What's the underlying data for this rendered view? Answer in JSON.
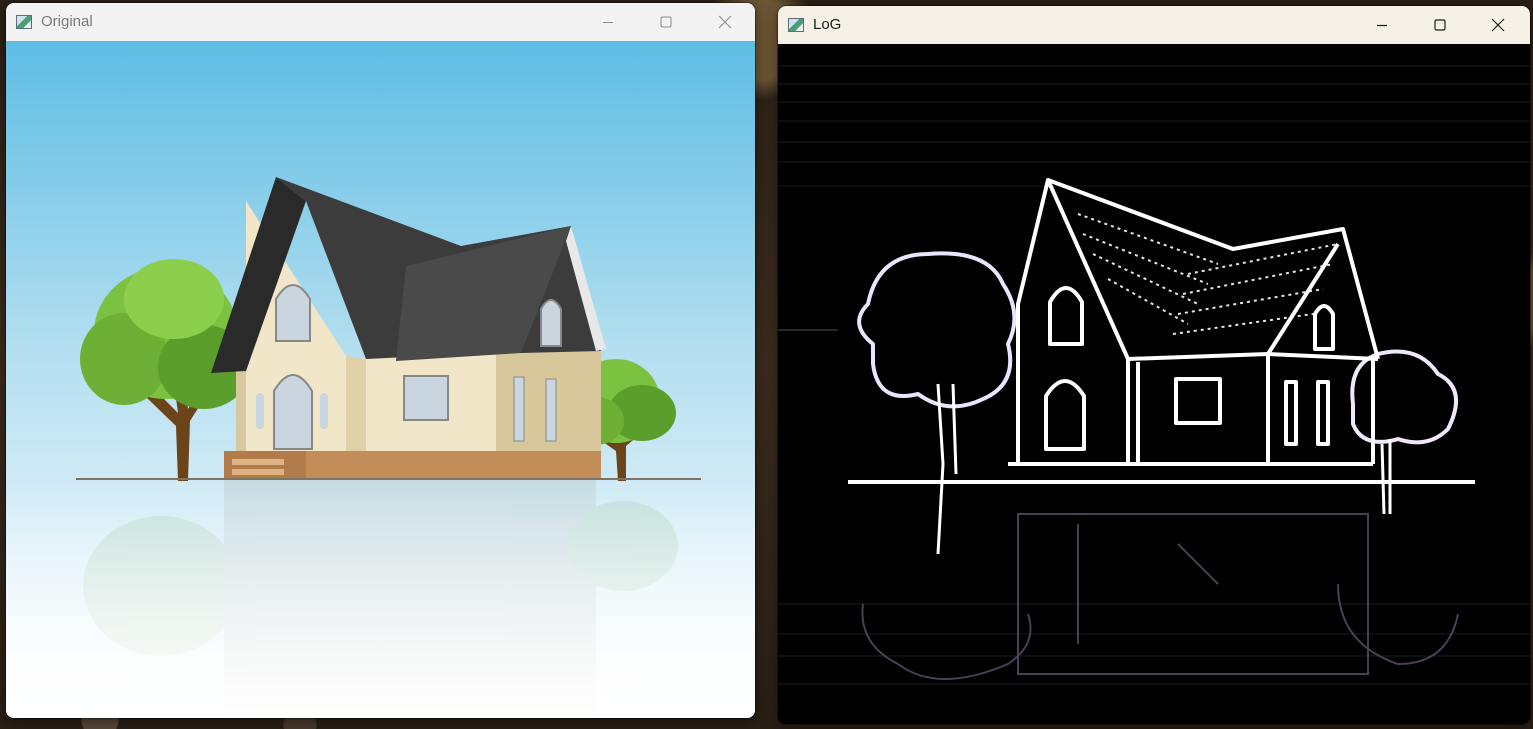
{
  "windows": [
    {
      "title": "Original",
      "icon": "opencv-window-icon",
      "controls": [
        "minimize-icon",
        "maximize-icon",
        "close-icon"
      ]
    },
    {
      "title": "LoG",
      "icon": "opencv-window-icon",
      "controls": [
        "minimize-icon",
        "maximize-icon",
        "close-icon"
      ]
    }
  ],
  "colors": {
    "sky_top": "#5dbde4",
    "sky_bottom": "#ffffff",
    "tree_green": "#7cc241",
    "roof_dark": "#3c3c3c",
    "wall_cream": "#f1e6c8",
    "edge_bg": "#000000",
    "edge_line": "#ffffff"
  }
}
